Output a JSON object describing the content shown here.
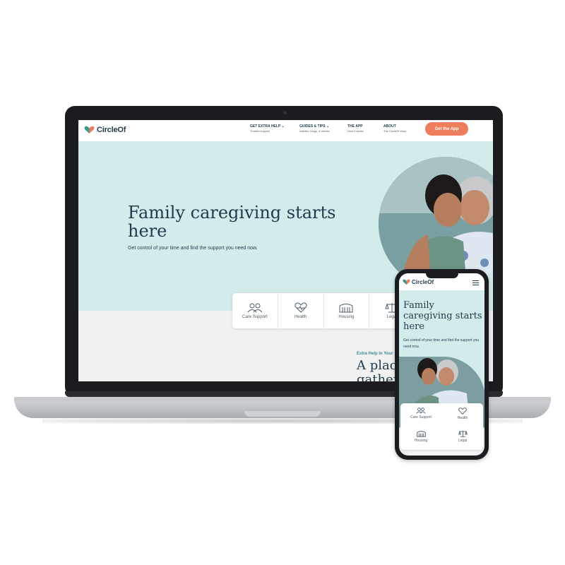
{
  "brand": {
    "name": "CircleOf",
    "colors": {
      "navy": "#1d3b4d",
      "teal_bg": "#d3ebea",
      "coral": "#ee7d5d",
      "heart_green": "#3d9a8a"
    }
  },
  "nav": {
    "items": [
      {
        "label": "GET EXTRA HELP",
        "sublabel": "Trusted support",
        "has_dropdown": true
      },
      {
        "label": "GUIDES & TIPS",
        "sublabel": "Articles, blogs, & stories",
        "has_dropdown": true
      },
      {
        "label": "THE APP",
        "sublabel": "How it works",
        "has_dropdown": false
      },
      {
        "label": "ABOUT",
        "sublabel": "The CircleOf story",
        "has_dropdown": false
      }
    ],
    "cta_label": "Get the App"
  },
  "hero": {
    "title": "Family caregiving starts here",
    "subtitle": "Get control of your time and find the support you need now."
  },
  "categories": [
    {
      "label": "Care Support",
      "icon": "people-icon"
    },
    {
      "label": "Health",
      "icon": "heart-pulse-icon"
    },
    {
      "label": "Housing",
      "icon": "building-icon"
    },
    {
      "label": "Legal",
      "icon": "scales-icon"
    }
  ],
  "section": {
    "eyebrow": "Extra Help in Your",
    "title_line1": "A plac",
    "title_line2": "gather"
  },
  "mobile": {
    "hero_title": "Family caregiving starts here",
    "hero_subtitle": "Get control of your time and find the support you need now.",
    "categories": [
      {
        "label": "Care Support",
        "icon": "people-icon"
      },
      {
        "label": "Health",
        "icon": "heart-pulse-icon"
      },
      {
        "label": "Housing",
        "icon": "building-icon"
      },
      {
        "label": "Legal",
        "icon": "scales-icon"
      }
    ]
  }
}
